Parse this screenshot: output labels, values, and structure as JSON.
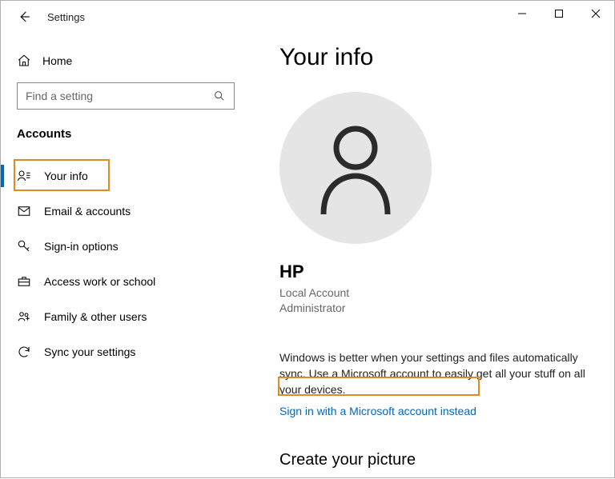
{
  "window": {
    "title": "Settings"
  },
  "sidebar": {
    "home_label": "Home",
    "search_placeholder": "Find a setting",
    "category_label": "Accounts",
    "items": [
      {
        "label": "Your info"
      },
      {
        "label": "Email & accounts"
      },
      {
        "label": "Sign-in options"
      },
      {
        "label": "Access work or school"
      },
      {
        "label": "Family & other users"
      },
      {
        "label": "Sync your settings"
      }
    ]
  },
  "main": {
    "page_title": "Your info",
    "user_name": "HP",
    "account_type": "Local Account",
    "role": "Administrator",
    "description": "Windows is better when your settings and files automatically sync. Use a Microsoft account to easily get all your stuff on all your devices.",
    "signin_link": "Sign in with a Microsoft account instead",
    "create_picture_heading": "Create your picture"
  }
}
